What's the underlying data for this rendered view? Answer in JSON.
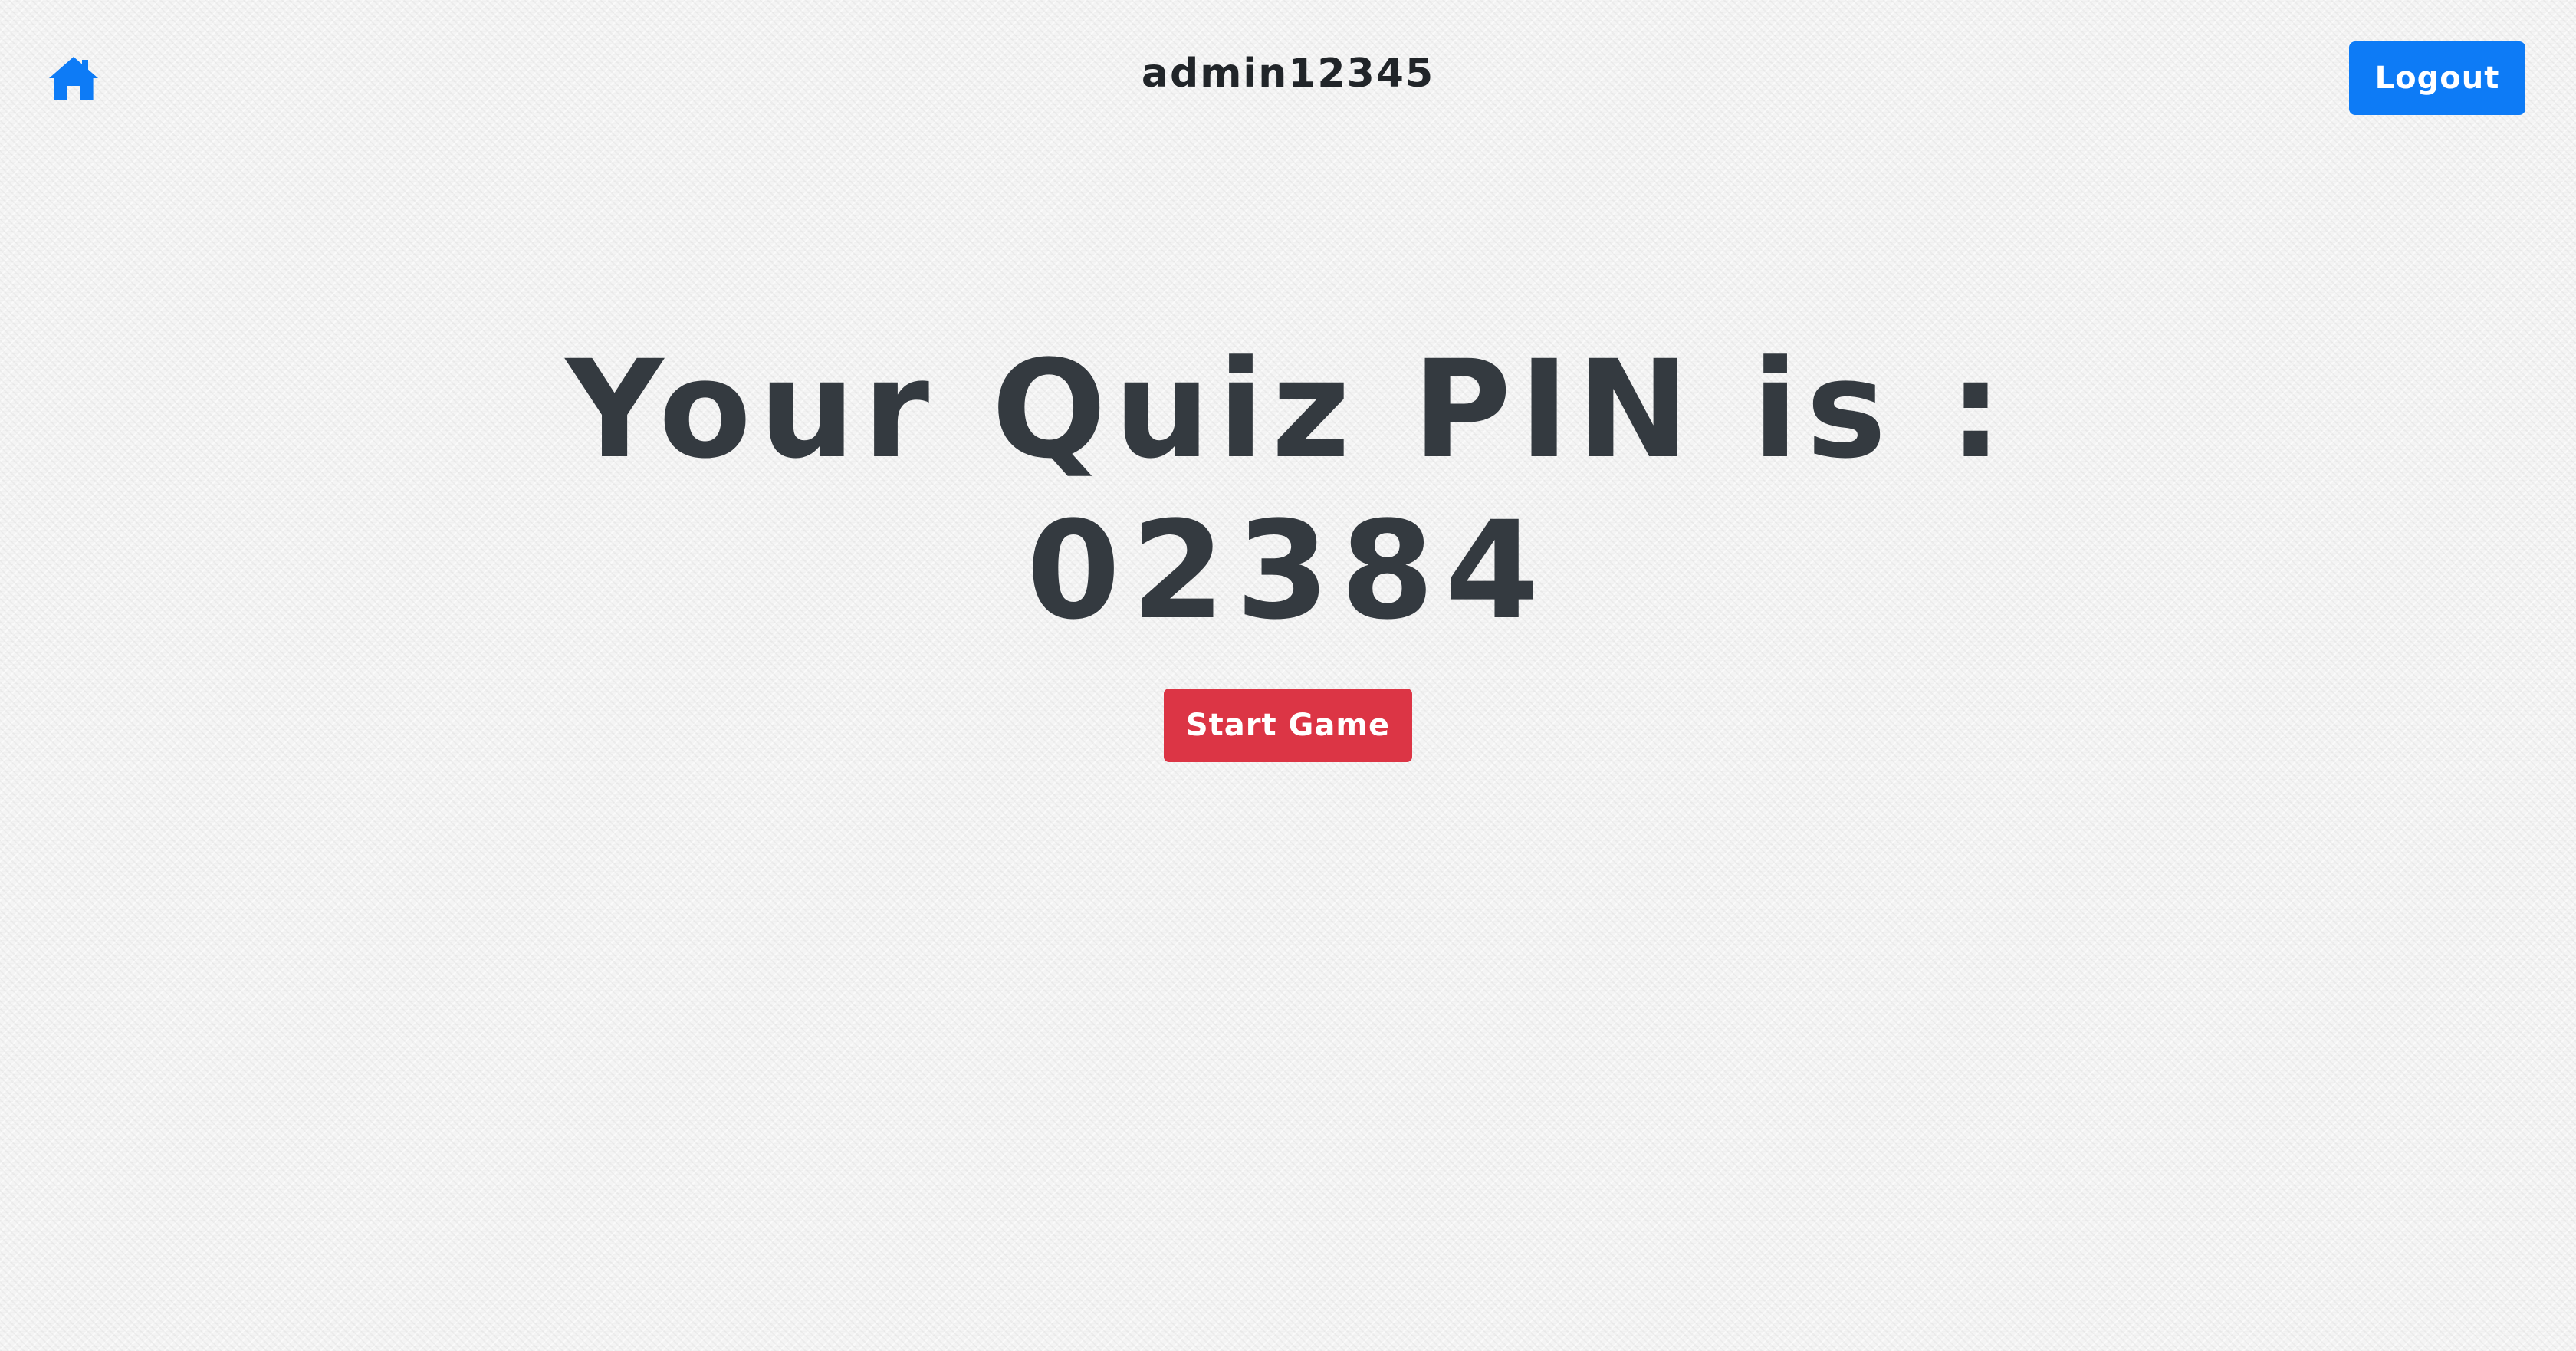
{
  "navbar": {
    "home_icon": "home-icon",
    "username": "admin12345",
    "logout_label": "Logout"
  },
  "pin": {
    "heading": "Your Quiz PIN is :",
    "value": "02384"
  },
  "actions": {
    "start_label": "Start Game"
  },
  "colors": {
    "primary": "#0d7bf6",
    "danger": "#dc3545",
    "text": "#343a40"
  }
}
